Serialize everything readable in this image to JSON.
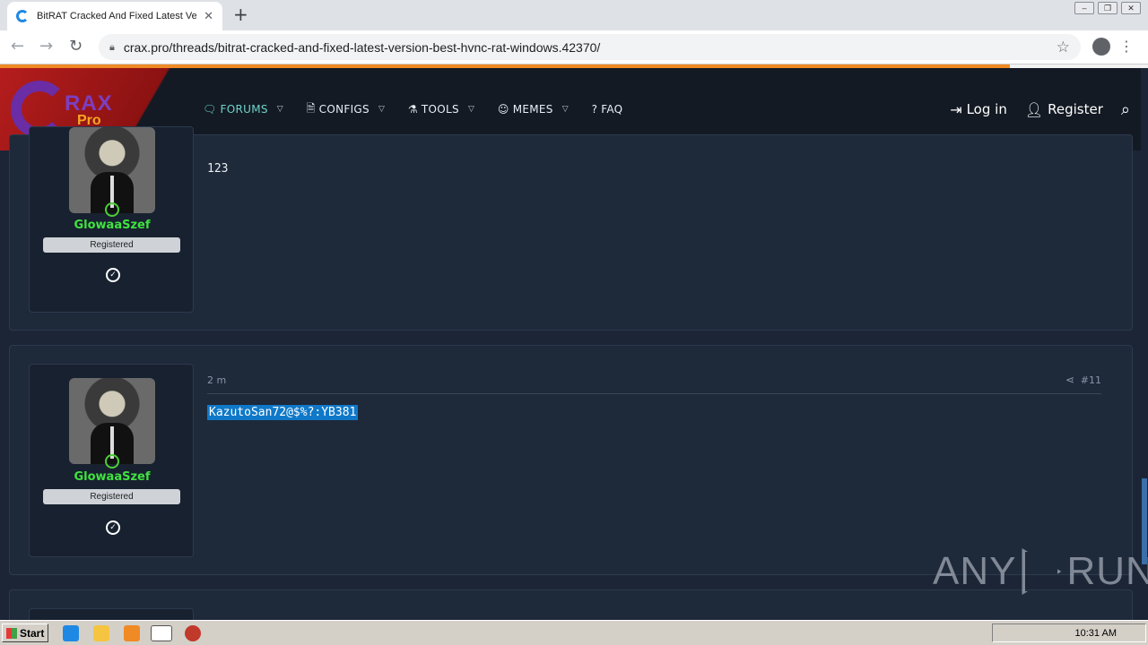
{
  "browser": {
    "tab_title": "BitRAT Cracked And Fixed Latest Ve",
    "tab_close": "✕",
    "new_tab": "+",
    "url": "crax.pro/threads/bitrat-cracked-and-fixed-latest-version-best-hvnc-rat-windows.42370/",
    "page_load_progress_pct": 88
  },
  "site": {
    "logo_rax": "RAX",
    "logo_pro": "Pro",
    "nav": [
      {
        "label": "FORUMS",
        "icon": "chat-icon"
      },
      {
        "label": "CONFIGS",
        "icon": "file-icon"
      },
      {
        "label": "TOOLS",
        "icon": "tools-icon"
      },
      {
        "label": "MEMES",
        "icon": "meme-icon"
      },
      {
        "label": "FAQ",
        "icon": "question-icon"
      }
    ],
    "login": "Log in",
    "register": "Register"
  },
  "posts": [
    {
      "username": "GlowaaSzef",
      "badge": "Registered",
      "message": "123"
    },
    {
      "username": "GlowaaSzef",
      "badge": "Registered",
      "time": "2 m",
      "post_number": "#11",
      "message": "KazutoSan72@$%?:YB381"
    }
  ],
  "watermark": {
    "left": "ANY",
    "right": "RUN"
  },
  "taskbar": {
    "start": "Start",
    "clock": "10:31 AM"
  }
}
